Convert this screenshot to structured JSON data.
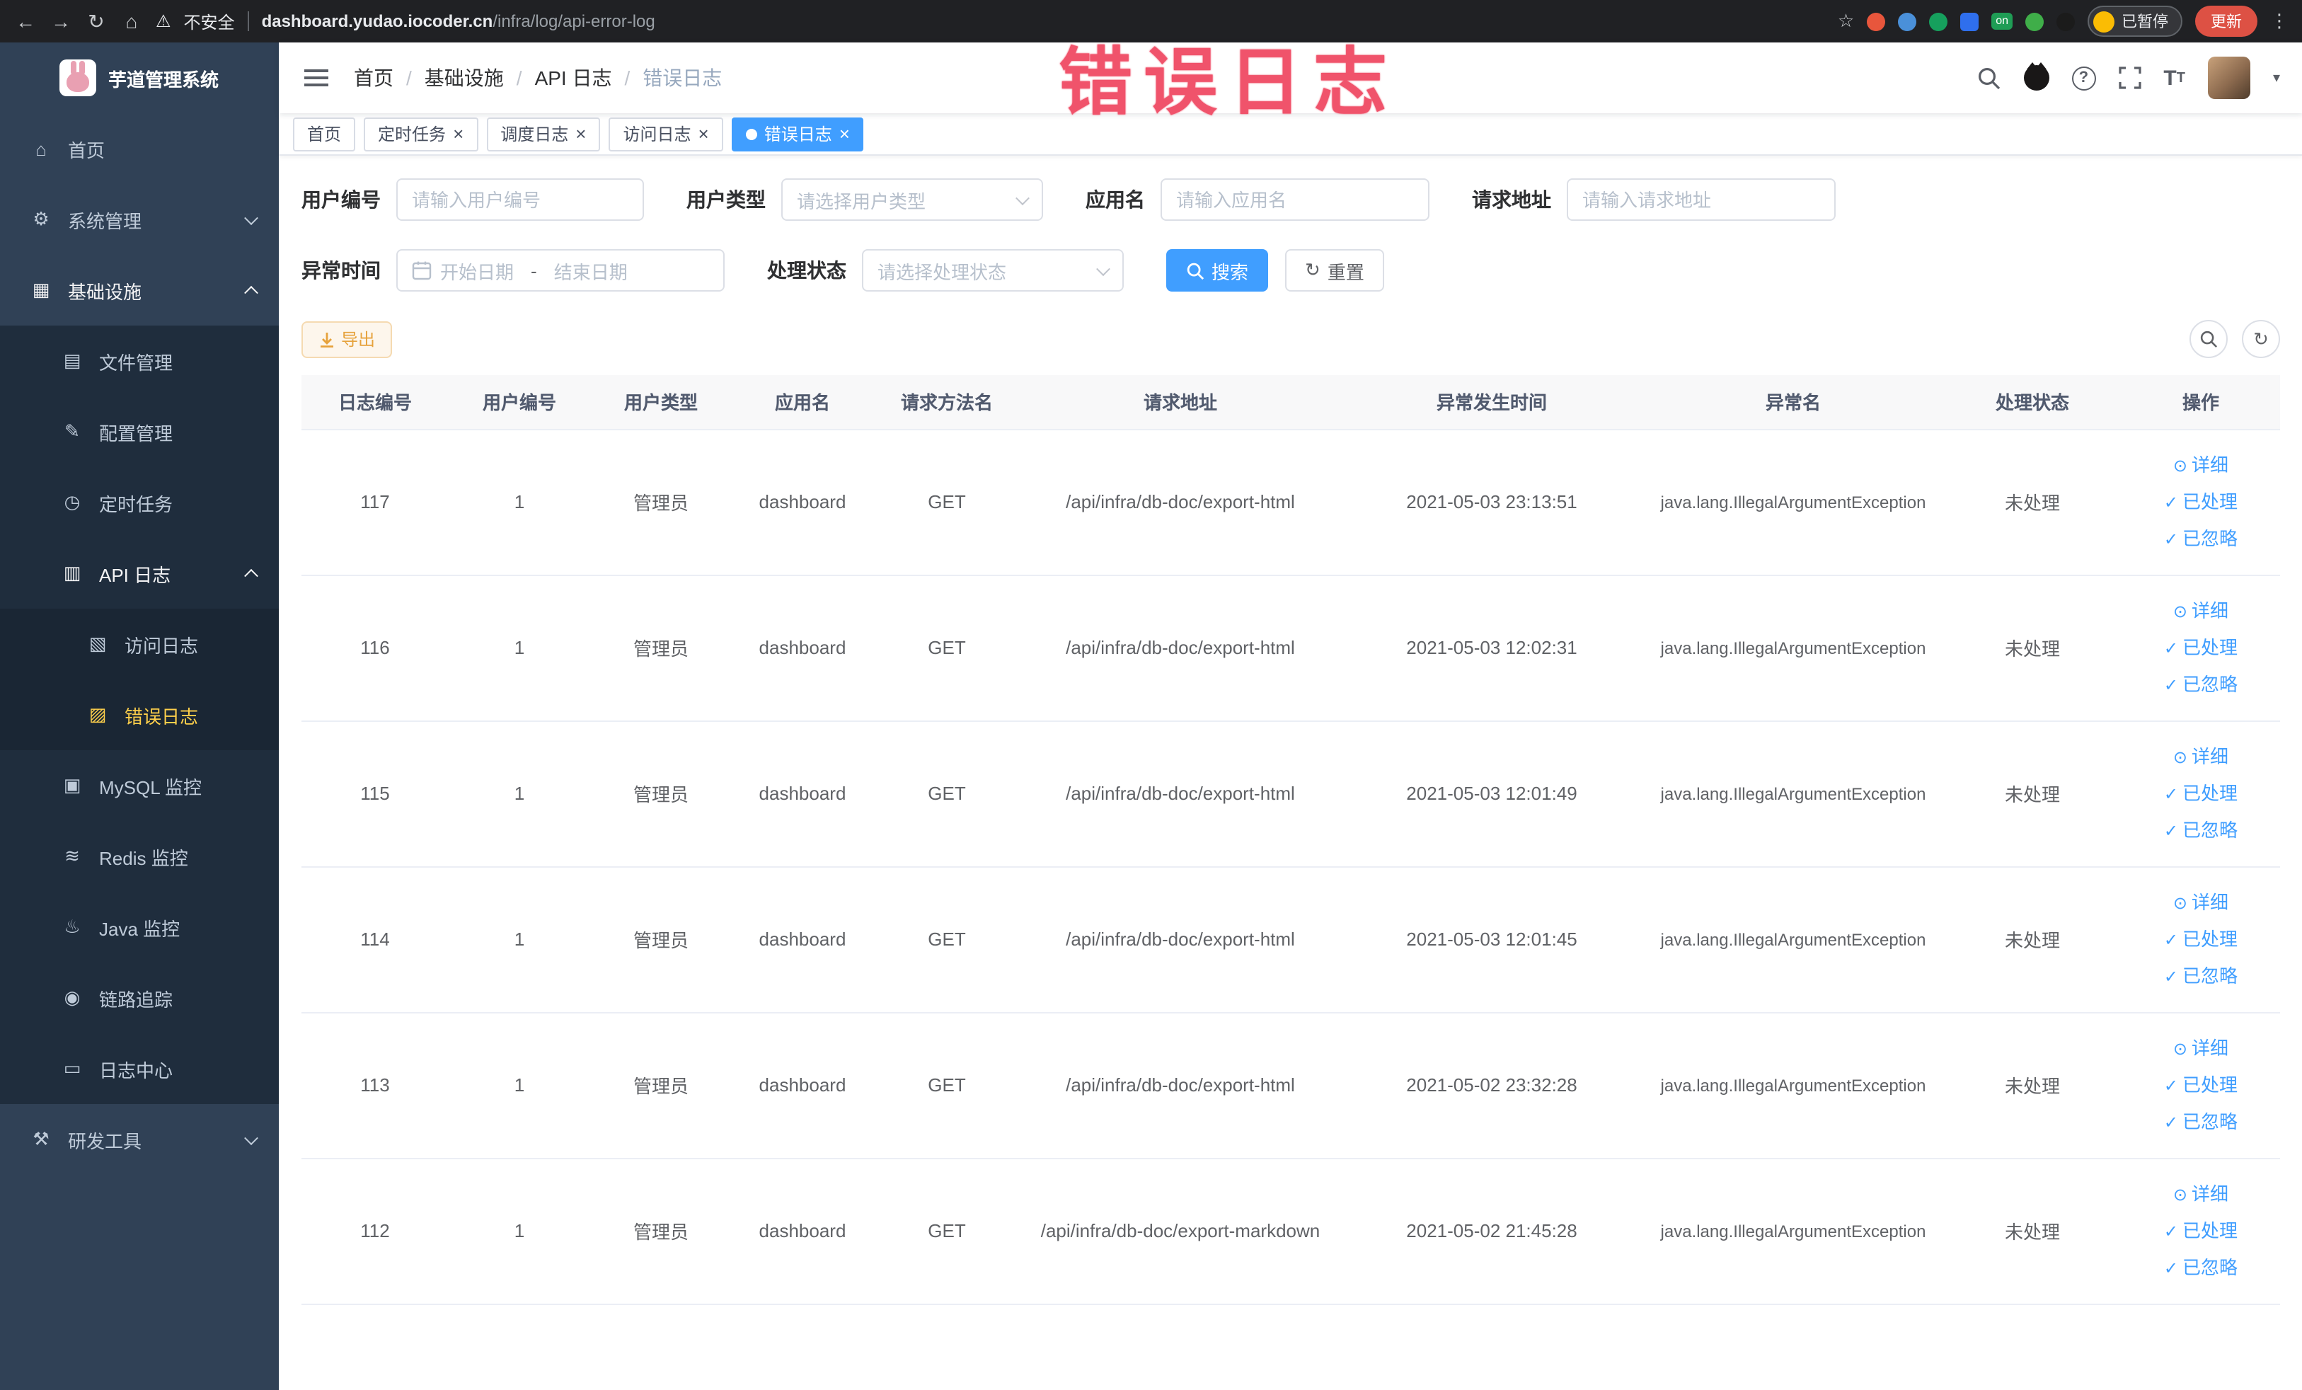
{
  "colors": {
    "accent": "#409eff",
    "sidebar_bg": "#304156",
    "sidebar_sub_bg": "#1f2d3d",
    "sidebar_active_text": "#ffd04b",
    "warning": "#e6a23c",
    "annotation_red": "#f0536b",
    "update_button_red": "#dd5144",
    "active_tab_bg": "#409eff"
  },
  "browser": {
    "security_label": "不安全",
    "url_host": "dashboard.yudao.iocoder.cn",
    "url_path": "/infra/log/api-error-log",
    "extension_badge": "on",
    "paused_label": "已暂停",
    "update_label": "更新"
  },
  "annotation": {
    "text": "错误日志"
  },
  "sidebar": {
    "logo_title": "芋道管理系统",
    "items": [
      {
        "id": "home",
        "label": "首页",
        "icon": "home-icon",
        "glyph": "⌂",
        "level": 1
      },
      {
        "id": "system",
        "label": "系统管理",
        "icon": "gear-icon",
        "glyph": "⚙",
        "level": 1,
        "arrow": "down"
      },
      {
        "id": "infra",
        "label": "基础设施",
        "icon": "grid-icon",
        "glyph": "▦",
        "level": 1,
        "arrow": "up",
        "emphasis": true
      },
      {
        "id": "file",
        "label": "文件管理",
        "icon": "folder-icon",
        "glyph": "▤",
        "level": 2
      },
      {
        "id": "config",
        "label": "配置管理",
        "icon": "edit-icon",
        "glyph": "✎",
        "level": 2
      },
      {
        "id": "job",
        "label": "定时任务",
        "icon": "clock-icon",
        "glyph": "◷",
        "level": 2
      },
      {
        "id": "api-log",
        "label": "API 日志",
        "icon": "document-icon",
        "glyph": "▥",
        "level": 2,
        "arrow": "up",
        "emphasis": true
      },
      {
        "id": "access-log",
        "label": "访问日志",
        "icon": "document-icon",
        "glyph": "▧",
        "level": 3
      },
      {
        "id": "error-log",
        "label": "错误日志",
        "icon": "document-icon",
        "glyph": "▨",
        "level": 3,
        "active": true
      },
      {
        "id": "mysql",
        "label": "MySQL 监控",
        "icon": "monitor-icon",
        "glyph": "▣",
        "level": 2
      },
      {
        "id": "redis",
        "label": "Redis 监控",
        "icon": "database-icon",
        "glyph": "≋",
        "level": 2
      },
      {
        "id": "java",
        "label": "Java 监控",
        "icon": "coffee-icon",
        "glyph": "♨",
        "level": 2
      },
      {
        "id": "trace",
        "label": "链路追踪",
        "icon": "trace-icon",
        "glyph": "◉",
        "level": 2
      },
      {
        "id": "log-center",
        "label": "日志中心",
        "icon": "log-icon",
        "glyph": "▭",
        "level": 2
      },
      {
        "id": "devtools",
        "label": "研发工具",
        "icon": "tools-icon",
        "glyph": "⚒",
        "level": 1,
        "arrow": "down"
      }
    ]
  },
  "header": {
    "breadcrumb": [
      {
        "label": "首页",
        "current": false
      },
      {
        "label": "基础设施",
        "current": false
      },
      {
        "label": "API 日志",
        "current": false
      },
      {
        "label": "错误日志",
        "current": true
      }
    ]
  },
  "tabs": [
    {
      "label": "首页",
      "closable": false,
      "active": false
    },
    {
      "label": "定时任务",
      "closable": true,
      "active": false
    },
    {
      "label": "调度日志",
      "closable": true,
      "active": false
    },
    {
      "label": "访问日志",
      "closable": true,
      "active": false
    },
    {
      "label": "错误日志",
      "closable": true,
      "active": true
    }
  ],
  "filters": {
    "user_id": {
      "label": "用户编号",
      "placeholder": "请输入用户编号"
    },
    "user_type": {
      "label": "用户类型",
      "placeholder": "请选择用户类型"
    },
    "app_name": {
      "label": "应用名",
      "placeholder": "请输入应用名"
    },
    "request_url": {
      "label": "请求地址",
      "placeholder": "请输入请求地址"
    },
    "exception_time": {
      "label": "异常时间",
      "start_placeholder": "开始日期",
      "separator": "-",
      "end_placeholder": "结束日期"
    },
    "process_status": {
      "label": "处理状态",
      "placeholder": "请选择处理状态"
    },
    "search_label": "搜索",
    "reset_label": "重置"
  },
  "toolbar": {
    "export_label": "导出"
  },
  "table": {
    "columns": [
      "日志编号",
      "用户编号",
      "用户类型",
      "应用名",
      "请求方法名",
      "请求地址",
      "异常发生时间",
      "异常名",
      "处理状态",
      "操作"
    ],
    "actions": [
      "详细",
      "已处理",
      "已忽略"
    ],
    "rows": [
      {
        "id": "117",
        "user_id": "1",
        "user_type": "管理员",
        "app": "dashboard",
        "method": "GET",
        "url": "/api/infra/db-doc/export-html",
        "time": "2021-05-03 23:13:51",
        "exception": "java.lang.IllegalArgumentException",
        "status": "未处理"
      },
      {
        "id": "116",
        "user_id": "1",
        "user_type": "管理员",
        "app": "dashboard",
        "method": "GET",
        "url": "/api/infra/db-doc/export-html",
        "time": "2021-05-03 12:02:31",
        "exception": "java.lang.IllegalArgumentException",
        "status": "未处理"
      },
      {
        "id": "115",
        "user_id": "1",
        "user_type": "管理员",
        "app": "dashboard",
        "method": "GET",
        "url": "/api/infra/db-doc/export-html",
        "time": "2021-05-03 12:01:49",
        "exception": "java.lang.IllegalArgumentException",
        "status": "未处理"
      },
      {
        "id": "114",
        "user_id": "1",
        "user_type": "管理员",
        "app": "dashboard",
        "method": "GET",
        "url": "/api/infra/db-doc/export-html",
        "time": "2021-05-03 12:01:45",
        "exception": "java.lang.IllegalArgumentException",
        "status": "未处理"
      },
      {
        "id": "113",
        "user_id": "1",
        "user_type": "管理员",
        "app": "dashboard",
        "method": "GET",
        "url": "/api/infra/db-doc/export-html",
        "time": "2021-05-02 23:32:28",
        "exception": "java.lang.IllegalArgumentException",
        "status": "未处理"
      },
      {
        "id": "112",
        "user_id": "1",
        "user_type": "管理员",
        "app": "dashboard",
        "method": "GET",
        "url": "/api/infra/db-doc/export-markdown",
        "time": "2021-05-02 21:45:28",
        "exception": "java.lang.IllegalArgumentException",
        "status": "未处理"
      }
    ]
  }
}
